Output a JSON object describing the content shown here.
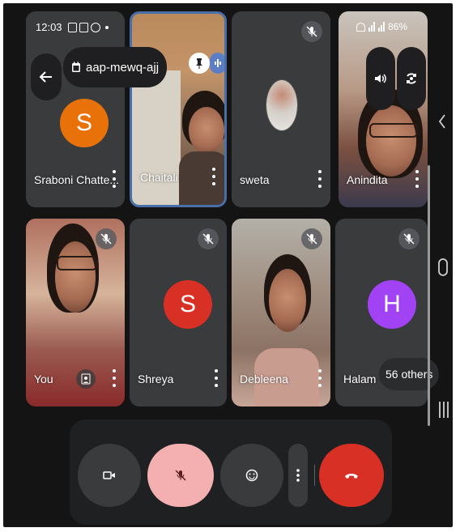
{
  "status_bar": {
    "time": "12:03",
    "battery": "86%"
  },
  "meeting": {
    "code": "aap-mewq-ajj"
  },
  "participants": [
    {
      "name": "Sraboni Chatte...",
      "initial": "S",
      "avatar_color": "#e8710a"
    },
    {
      "name": "Chaitali"
    },
    {
      "name": "sweta"
    },
    {
      "name": "Anindita"
    },
    {
      "name": "You"
    },
    {
      "name": "Shreya",
      "initial": "S",
      "avatar_color": "#d93025"
    },
    {
      "name": "Debleena"
    },
    {
      "name": "Halam",
      "initial": "H",
      "avatar_color": "#a142f4"
    }
  ],
  "others": {
    "label": "56 others"
  },
  "controls": {
    "camera": "camera-off-icon",
    "mic": "mic-off-icon",
    "reactions": "emoji-icon",
    "more": "more-vert-icon",
    "hangup": "hangup-icon"
  },
  "colors": {
    "background": "#141414",
    "tile": "#3a3b3d",
    "mic_button": "#f4b0b0",
    "hangup_button": "#d93025",
    "active_border": "#4a6ea8"
  }
}
